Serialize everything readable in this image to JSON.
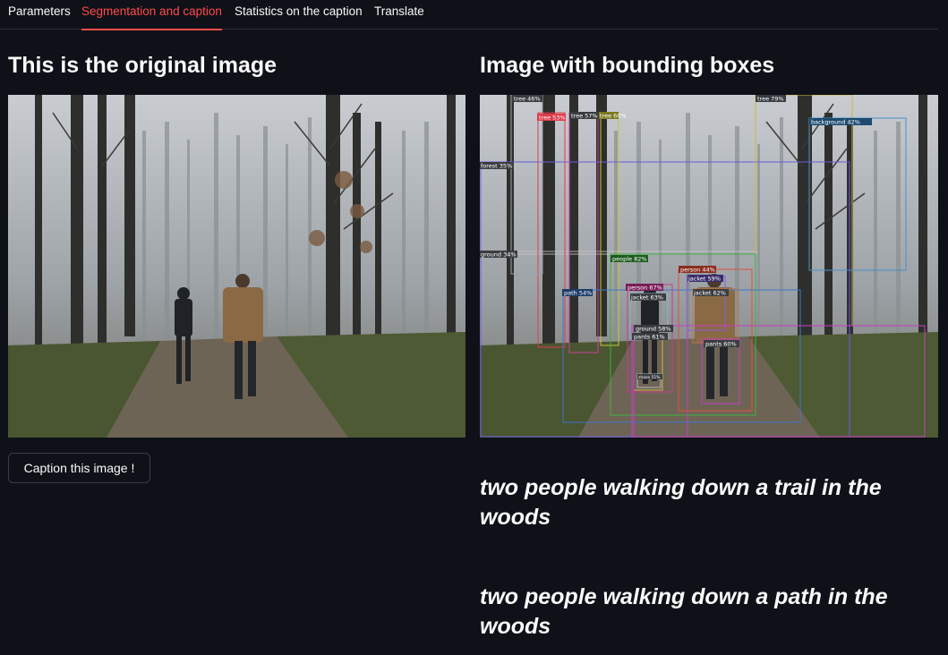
{
  "tabs": [
    {
      "label": "Parameters",
      "active": false
    },
    {
      "label": "Segmentation and caption",
      "active": true
    },
    {
      "label": "Statistics on the caption",
      "active": false
    },
    {
      "label": "Translate",
      "active": false
    }
  ],
  "left": {
    "title": "This is the original image",
    "caption_button": "Caption this image !"
  },
  "right": {
    "title": "Image with bounding boxes",
    "detections": [
      {
        "label": "tree 46%",
        "color": "#9aa3b0"
      },
      {
        "label": "tree 53%",
        "color": "#e03c4b"
      },
      {
        "label": "tree 57%",
        "color": "#d040a0"
      },
      {
        "label": "tree 60%",
        "color": "#c8c832"
      },
      {
        "label": "tree 79%",
        "color": "#d4b43c"
      },
      {
        "label": "background 42%",
        "color": "#4a90c8"
      },
      {
        "label": "forest 35%",
        "color": "#6a5ae0"
      },
      {
        "label": "ground 34%",
        "color": "#c8c8c8"
      },
      {
        "label": "people 82%",
        "color": "#3cb43c"
      },
      {
        "label": "person 67%",
        "color": "#c83c8c"
      },
      {
        "label": "person 44%",
        "color": "#e0503c"
      },
      {
        "label": "path 54%",
        "color": "#3c78c8"
      },
      {
        "label": "jacket 63%",
        "color": "#8ab4c8"
      },
      {
        "label": "jacket 59%",
        "color": "#8a5ae0"
      },
      {
        "label": "jacket 62%",
        "color": "#c8783c"
      },
      {
        "label": "ground 58%",
        "color": "#d0d0d0"
      },
      {
        "label": "pants 61%",
        "color": "#d0b43c"
      },
      {
        "label": "pants 60%",
        "color": "#c83cc8"
      },
      {
        "label": "shoes 51%",
        "color": "#b4b4b4"
      }
    ],
    "captions": [
      "two people walking down a trail in the woods",
      "two people walking down a path in the woods"
    ]
  },
  "colors": {
    "background": "#0e1117",
    "accent": "#ff4b4b",
    "text": "#fafafa",
    "border": "#3a3d46"
  }
}
